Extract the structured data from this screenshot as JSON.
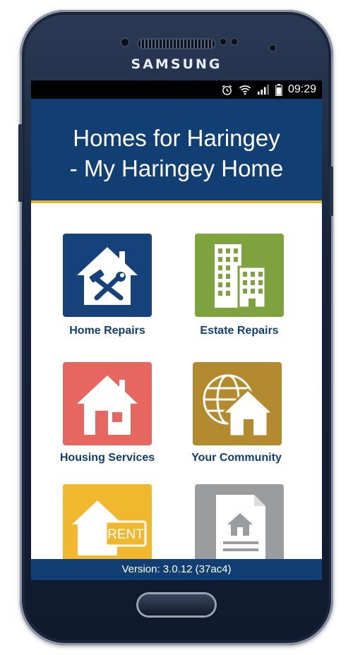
{
  "device": {
    "brand": "SAMSUNG"
  },
  "status_bar": {
    "time": "09:29",
    "icons": [
      "alarm-icon",
      "wifi-icon",
      "signal-icon",
      "battery-icon"
    ]
  },
  "header": {
    "title_line1": "Homes for Haringey",
    "title_line2": "- My Haringey Home"
  },
  "tiles": [
    {
      "label": "Home Repairs",
      "icon": "house-tools-icon",
      "color": "#15427a"
    },
    {
      "label": "Estate Repairs",
      "icon": "buildings-icon",
      "color": "#7ea23d"
    },
    {
      "label": "Housing Services",
      "icon": "house-icon",
      "color": "#e5675f"
    },
    {
      "label": "Your Community",
      "icon": "globe-house-icon",
      "color": "#b48a2f"
    },
    {
      "label": "",
      "icon": "house-rent-icon",
      "color": "#f0b72f"
    },
    {
      "label": "",
      "icon": "document-house-icon",
      "color": "#9b9c9e"
    }
  ],
  "footer": {
    "version": "Version: 3.0.12 (37ac4)"
  },
  "colors": {
    "header_bg": "#123f73",
    "accent_stripe": "#e9b230",
    "label_text": "#123f73"
  }
}
